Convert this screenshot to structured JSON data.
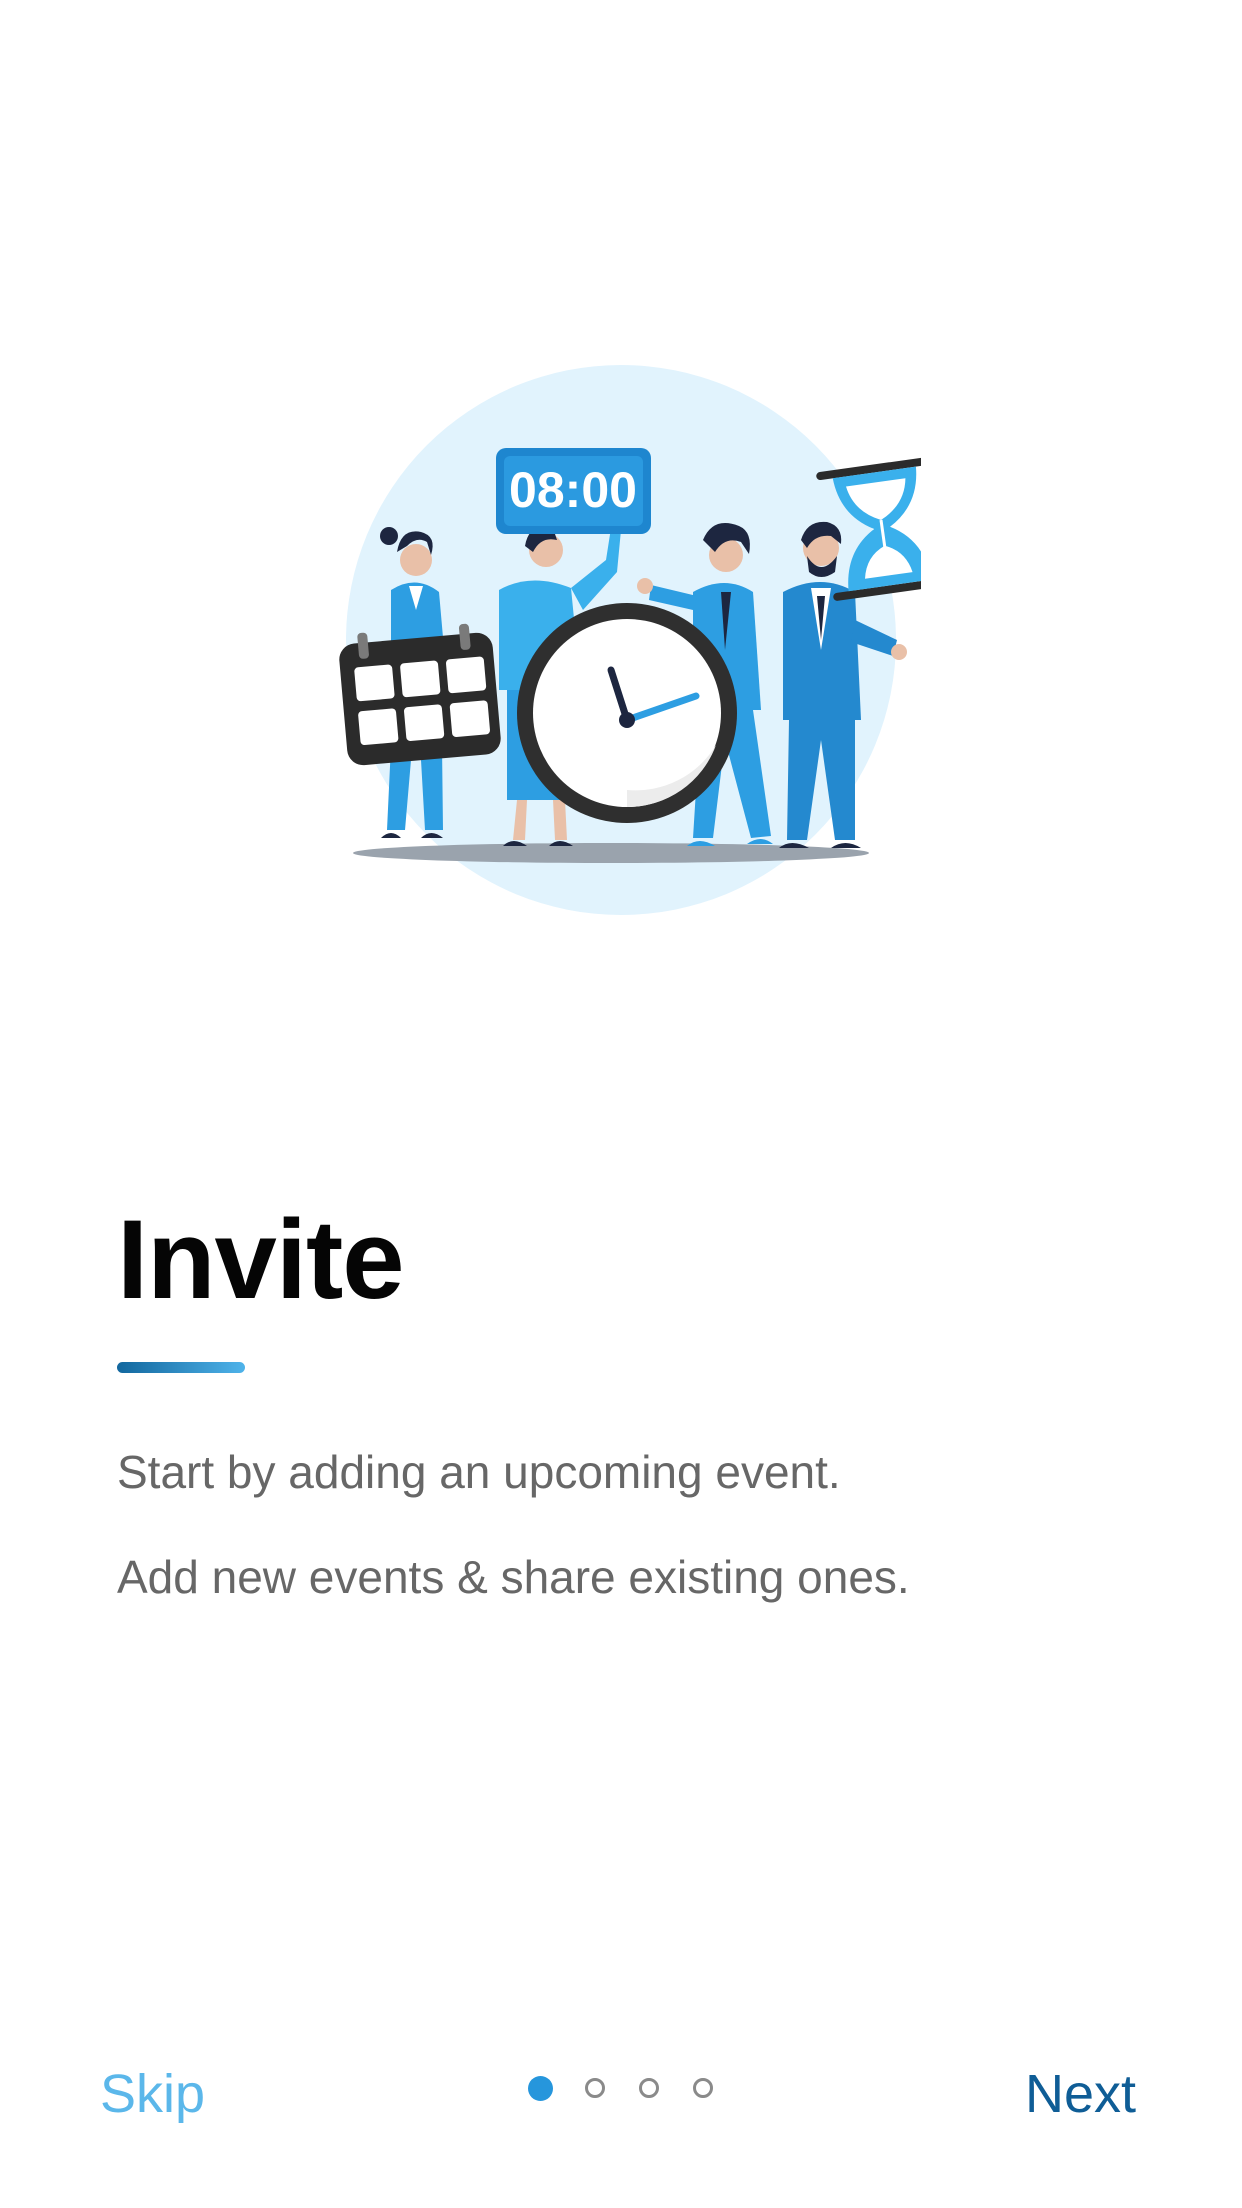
{
  "illustration": {
    "timer_display": "08:00",
    "icon": "onboarding-event-illustration"
  },
  "onboarding": {
    "title": "Invite",
    "lines": [
      "Start by adding an upcoming event.",
      "Add new events & share existing ones."
    ]
  },
  "footer": {
    "skip_label": "Skip",
    "next_label": "Next",
    "page_count": 4,
    "current_page": 1
  },
  "colors": {
    "accent": "#2696dc",
    "skip": "#5bb7ea",
    "next": "#0f5d96",
    "title": "#050505",
    "body_text": "#676767"
  }
}
